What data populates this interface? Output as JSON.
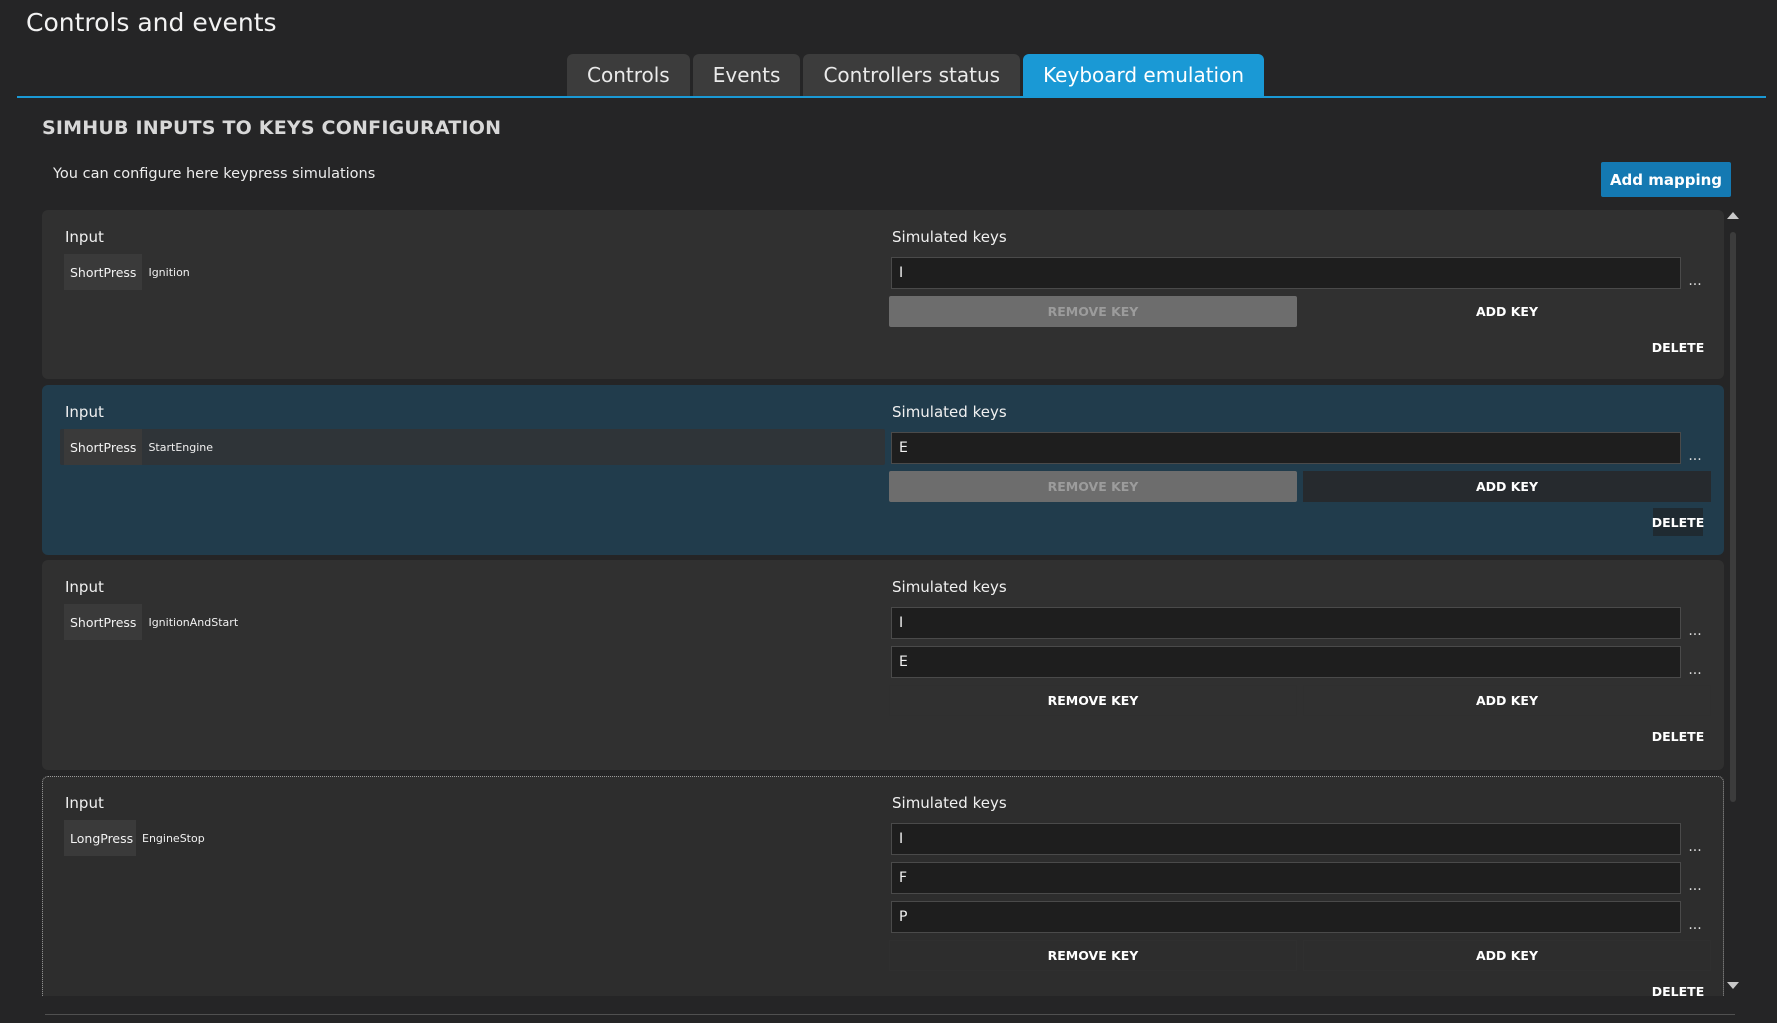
{
  "app": {
    "title": "Controls and events"
  },
  "tabs": [
    {
      "label": "Controls",
      "active": false
    },
    {
      "label": "Events",
      "active": false
    },
    {
      "label": "Controllers status",
      "active": false
    },
    {
      "label": "Keyboard emulation",
      "active": true
    }
  ],
  "section": {
    "title": "SIMHUB INPUTS TO KEYS CONFIGURATION",
    "description": "You can configure here keypress simulations",
    "add_mapping_label": "Add mapping"
  },
  "labels": {
    "input": "Input",
    "simulated_keys": "Simulated keys",
    "remove_key": "REMOVE KEY",
    "add_key": "ADD KEY",
    "delete": "DELETE",
    "more": "..."
  },
  "mappings": [
    {
      "input_type": "ShortPress",
      "input_name": "Ignition",
      "keys": [
        "I"
      ]
    },
    {
      "input_type": "ShortPress",
      "input_name": "StartEngine",
      "keys": [
        "E"
      ]
    },
    {
      "input_type": "ShortPress",
      "input_name": "IgnitionAndStart",
      "keys": [
        "I",
        "E"
      ]
    },
    {
      "input_type": "LongPress",
      "input_name": "EngineStop",
      "keys": [
        "I",
        "F",
        "P"
      ]
    }
  ],
  "colors": {
    "accent": "#1a99d5",
    "background": "#252526",
    "card": "#303030",
    "card_selected": "#213c4c"
  }
}
